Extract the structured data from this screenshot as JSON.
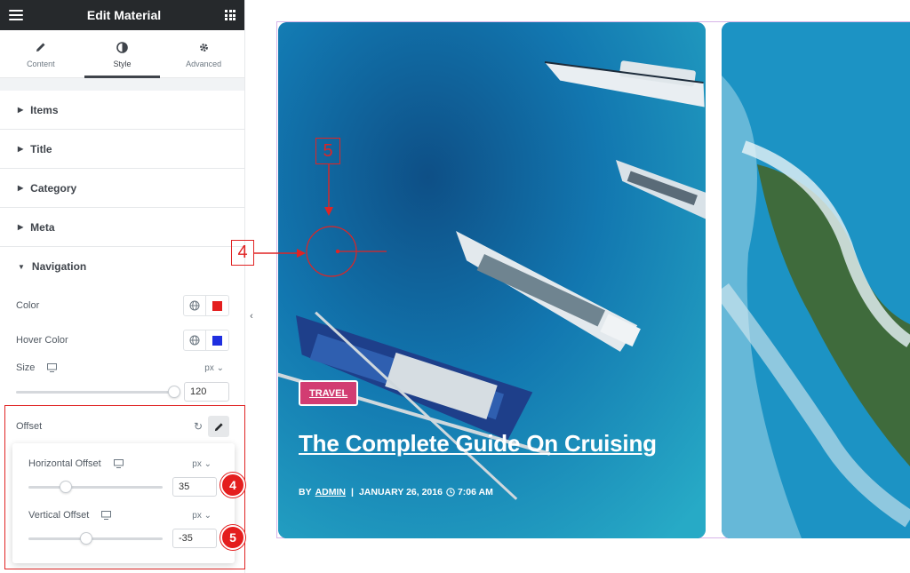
{
  "header": {
    "title": "Edit Material"
  },
  "tabs": [
    {
      "label": "Content",
      "icon": "pencil-icon"
    },
    {
      "label": "Style",
      "icon": "half-circle-icon",
      "active": true
    },
    {
      "label": "Advanced",
      "icon": "gear-icon"
    }
  ],
  "sections": {
    "items": "Items",
    "title": "Title",
    "category": "Category",
    "meta": "Meta",
    "navigation": "Navigation"
  },
  "navigation": {
    "color_label": "Color",
    "color_value": "#e41e1e",
    "hover_label": "Hover Color",
    "hover_value": "#1f2fe0",
    "size_label": "Size",
    "size_unit": "px",
    "size_value": "120",
    "size_fraction": 1.0,
    "offset_label": "Offset",
    "horizontal_label": "Horizontal Offset",
    "horizontal_unit": "px",
    "horizontal_value": "35",
    "horizontal_fraction": 0.28,
    "vertical_label": "Vertical Offset",
    "vertical_unit": "px",
    "vertical_value": "-35",
    "vertical_fraction": 0.43
  },
  "annotations": {
    "badge_horizontal": "4",
    "badge_vertical": "5"
  },
  "post": {
    "category": "TRAVEL",
    "title": "The Complete Guide On Cruising",
    "by": "BY",
    "author": "ADMIN",
    "sep": "|",
    "date": "JANUARY 26, 2016",
    "time": "7:06 AM"
  },
  "colors": {
    "accent": "#e02424",
    "tag_bg": "#d23c72",
    "frame": "#d7b5e8"
  }
}
